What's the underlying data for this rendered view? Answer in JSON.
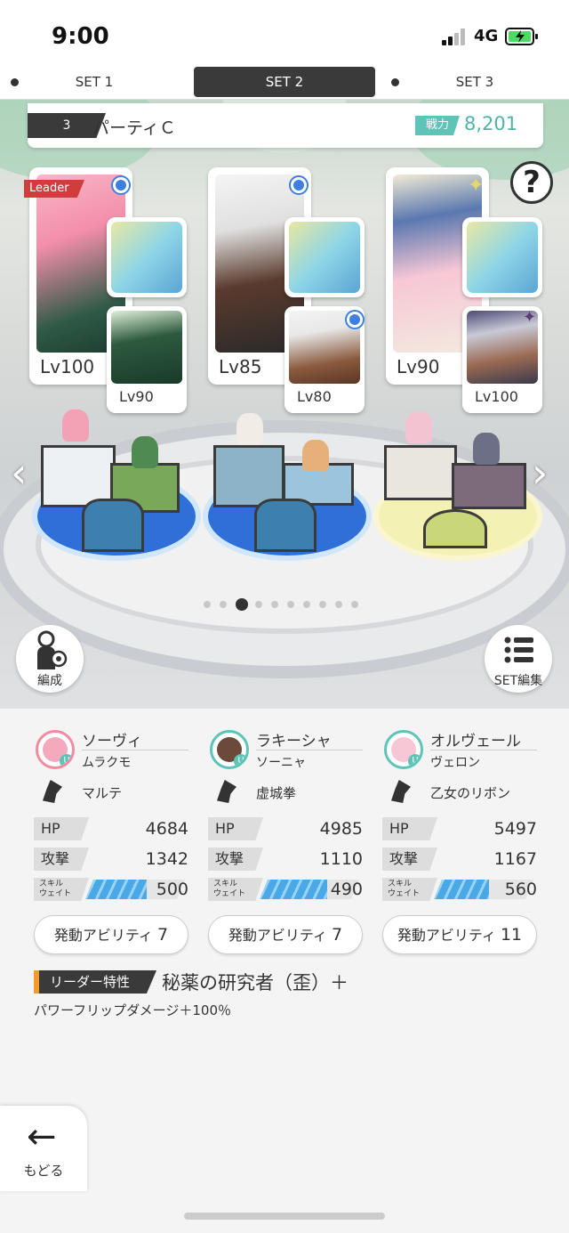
{
  "status": {
    "time": "9:00",
    "network": "4G"
  },
  "tabs": [
    {
      "label": "SET 1",
      "active": false
    },
    {
      "label": "SET 2",
      "active": true
    },
    {
      "label": "SET 3",
      "active": false
    }
  ],
  "party": {
    "number": "3",
    "name": "パーティＣ",
    "power_label": "戦力",
    "power_value": "8,201"
  },
  "help_label": "?",
  "cards": [
    {
      "leader_label": "Leader",
      "level": "Lv100",
      "sub_level": "Lv90"
    },
    {
      "level": "Lv85",
      "sub_level": "Lv80"
    },
    {
      "level": "Lv90",
      "sub_level": "Lv100"
    }
  ],
  "pager": {
    "count": 10,
    "active_index": 2
  },
  "buttons": {
    "formation": "編成",
    "set_edit": "SET編集",
    "back": "もどる"
  },
  "characters": [
    {
      "name": "ソーヴィ",
      "sub": "ムラクモ",
      "weapon": "マルテ",
      "hp_label": "HP",
      "hp": "4684",
      "atk_label": "攻撃",
      "atk": "1342",
      "skill_label": "スキル\nウェイト",
      "skill": "500",
      "skill_fill": 0.62,
      "ability_label": "発動アビリティ",
      "ability_count": "7",
      "accent": "#f08ba0"
    },
    {
      "name": "ラキーシャ",
      "sub": "ソーニャ",
      "weapon": "虚城拳",
      "hp_label": "HP",
      "hp": "4985",
      "atk_label": "攻撃",
      "atk": "1110",
      "skill_label": "スキル\nウェイト",
      "skill": "490",
      "skill_fill": 0.68,
      "ability_label": "発動アビリティ",
      "ability_count": "7",
      "accent": "#5fc4b8"
    },
    {
      "name": "オルヴェール",
      "sub": "ヴェロン",
      "weapon": "乙女のリボン",
      "hp_label": "HP",
      "hp": "5497",
      "atk_label": "攻撃",
      "atk": "1167",
      "skill_label": "スキル\nウェイト",
      "skill": "560",
      "skill_fill": 0.55,
      "ability_label": "発動アビリティ",
      "ability_count": "11",
      "accent": "#5fc4b8"
    }
  ],
  "leader_skill": {
    "tag": "リーダー特性",
    "name": "秘薬の研究者（歪）＋",
    "desc": "パワーフリップダメージ＋100％"
  },
  "colors": {
    "accent": "#5fc4b8",
    "dark": "#3a3a3a",
    "leader": "#d23c3c",
    "skill_bar": "#4aa8e6"
  }
}
